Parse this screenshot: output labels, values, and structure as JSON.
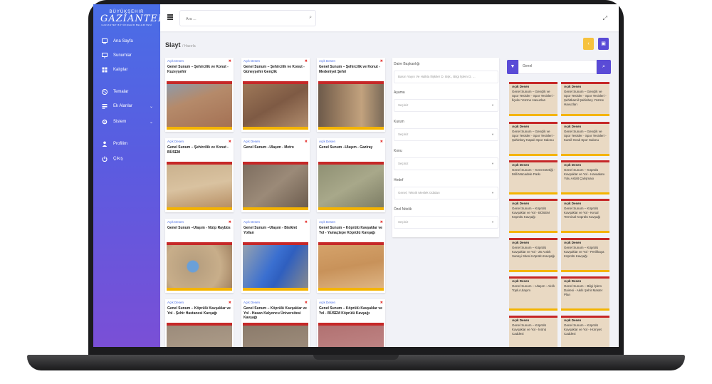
{
  "sidebar": {
    "logo_top": "BÜYÜKŞEHIR",
    "logo_main": "GAZİANTEP",
    "logo_sub": "GAZİANTEP BÜYÜKŞEHİR BELEDİYESİ",
    "items": [
      {
        "label": "Ana Sayfa",
        "icon": "monitor-icon"
      },
      {
        "label": "Sunumlar",
        "icon": "presentation-icon"
      },
      {
        "label": "Kalıplar",
        "icon": "template-icon"
      },
      {
        "label": "Temalar",
        "icon": "palette-icon"
      },
      {
        "label": "Ek Alanlar",
        "icon": "fields-icon"
      },
      {
        "label": "Sistem",
        "icon": "gear-icon"
      },
      {
        "label": "Profilim",
        "icon": "user-icon"
      },
      {
        "label": "Çıkış",
        "icon": "power-icon"
      }
    ]
  },
  "topbar": {
    "search_placeholder": "Ara ..."
  },
  "page": {
    "title": "Slayt",
    "breadcrumb": "/ Hazırla"
  },
  "slides": [
    {
      "tag": "Açık Desen",
      "title": "Genel Sunum – Şehircilik ve Konut - Kuzeyşehir"
    },
    {
      "tag": "Açık Desen",
      "title": "Genel Sunum – Şehircilik ve Konut - Güneyşehir Gençlik"
    },
    {
      "tag": "Açık Desen",
      "title": "Genel Sunum – Şehircilik ve Konut - Medeniyet Şehri"
    },
    {
      "tag": "Açık Desen",
      "title": "Genel Sunum – Şehircilik ve Konut - BÜSEM"
    },
    {
      "tag": "Açık Desen",
      "title": "Genel Sunum –Ulaşım - Metro"
    },
    {
      "tag": "Açık Desen",
      "title": "Genel Sunum –Ulaşım - Gaziray"
    },
    {
      "tag": "Açık Desen",
      "title": "Genel Sunum –Ulaşım - Nizip Raybüs"
    },
    {
      "tag": "Açık Desen",
      "title": "Genel Sunum –Ulaşım - Bisiklet Yolları"
    },
    {
      "tag": "Açık Desen",
      "title": "Genel Sunum – Köprülü Kavşaklar ve Yol - Yamaçtepe Köprülü Kavşağı"
    },
    {
      "tag": "Açık Desen",
      "title": "Genel Sunum – Köprülü Kavşaklar ve Yol - Şehir Hastanesi Kavşağı"
    },
    {
      "tag": "Açık Desen",
      "title": "Genel Sunum – Köprülü Kavşaklar ve Yol - Hasan Kalyoncu Üniversitesi Kavşağı"
    },
    {
      "tag": "Açık Desen",
      "title": "Genel Sunum – Köprülü Kavşaklar ve Yol - BÜSEM Köprülü Kavşağı"
    }
  ],
  "filters": [
    {
      "label": "Daire Başkanlığı",
      "value": "Basın Yayın Ve Halkla İlişkiler D. Bşk., Bilgi İşlem D. ..."
    },
    {
      "label": "Aşama",
      "value": "Seçiniz"
    },
    {
      "label": "Kurum",
      "value": "Seçiniz"
    },
    {
      "label": "Konu",
      "value": "Seçiniz"
    },
    {
      "label": "Hedef",
      "value": "Genel, Teknik Meslek Odaları"
    },
    {
      "label": "Özel Nitelik",
      "value": "Seçiniz"
    }
  ],
  "right_search": {
    "value": "Genel"
  },
  "templates": [
    {
      "tag": "Açık Desen",
      "text": "Genel Sunum – Gençlik ve Spor Tesisler - Spor Tesisleri - İlçeler Yüzme Havuzları"
    },
    {
      "tag": "Açık Desen",
      "text": "Genel Sunum – Gençlik ve Spor Tesisler - Spor Tesisleri - Şehitkamil Şahinbey Yüzme Havuzları"
    },
    {
      "tag": "Açık Desen",
      "text": "Genel Sunum – Gençlik ve Spor Tesisler - Spor Tesisleri - Şahinbey Kapalı Spor Salonu"
    },
    {
      "tag": "Açık Desen",
      "text": "Genel Sunum – Gençlik ve Spor Tesisler - Spor Tesisleri - Kamil Ocak Spor Salonu"
    },
    {
      "tag": "Açık Desen",
      "text": "Genel Sunum – Kent Estetiği - Milli Mücadele Parkı"
    },
    {
      "tag": "Açık Desen",
      "text": "Genel Sunum – Köprülü Kavşaklar ve Yol - Havaalanı Yolu Asfalt Çalışması"
    },
    {
      "tag": "Açık Desen",
      "text": "Genel Sunum – Köprülü Kavşaklar ve Yol - BÜSEM Köprülü Kavşağı"
    },
    {
      "tag": "Açık Desen",
      "text": "Genel Sunum – Köprülü Kavşaklar ve Yol - Kırsal Terminal Köprülü Kavşağı"
    },
    {
      "tag": "Açık Desen",
      "text": "Genel Sunum – Köprülü Kavşaklar ve Yol - 25 Aralık Sanayi Sitesi Köprülü Kavşağı"
    },
    {
      "tag": "Açık Desen",
      "text": "Genel Sunum – Köprülü Kavşaklar ve Yol - Perilikaya Köprülü Kavşağı"
    },
    {
      "tag": "Açık Desen",
      "text": "Genel Sunum – Ulaşım - Akıllı Toplu Ulaşım"
    },
    {
      "tag": "Açık Desen",
      "text": "Genel Sunum – Bilgi İşlem Dairesi - Akıllı Şehir Master Plan"
    },
    {
      "tag": "Açık Desen",
      "text": "Genel Sunum – Köprülü Kavşaklar ve Yol - İnönü Caddesi"
    },
    {
      "tag": "Açık Desen",
      "text": "Genel Sunum – Köprülü Kavşaklar ve Yol - Hürriyet Caddesi"
    }
  ],
  "colors": {
    "accent": "#5a4bd6",
    "warning": "#f6c23e",
    "danger": "#e53935"
  }
}
